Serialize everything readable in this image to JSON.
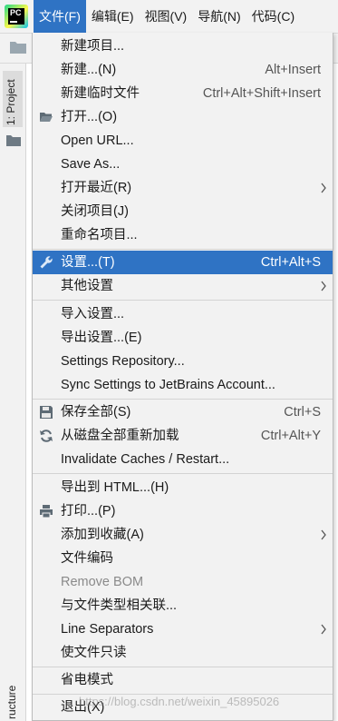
{
  "menubar": {
    "items": [
      "文件(F)",
      "编辑(E)",
      "视图(V)",
      "导航(N)",
      "代码(C)"
    ]
  },
  "tool_windows": {
    "project": "1: Project",
    "structure": "ructure"
  },
  "file_menu": {
    "items": [
      {
        "label": "新建项目...",
        "shortcut": ""
      },
      {
        "label": "新建...(N)",
        "shortcut": "Alt+Insert"
      },
      {
        "label": "新建临时文件",
        "shortcut": "Ctrl+Alt+Shift+Insert"
      },
      {
        "label": "打开...(O)",
        "shortcut": "",
        "icon": "folder-open-icon"
      },
      {
        "label": "Open URL...",
        "shortcut": ""
      },
      {
        "label": "Save As...",
        "shortcut": ""
      },
      {
        "label": "打开最近(R)",
        "shortcut": "",
        "submenu": true
      },
      {
        "label": "关闭项目(J)",
        "shortcut": ""
      },
      {
        "label": "重命名项目...",
        "shortcut": ""
      },
      {
        "label": "设置...(T)",
        "shortcut": "Ctrl+Alt+S",
        "icon": "wrench-icon",
        "selected": true
      },
      {
        "label": "其他设置",
        "shortcut": "",
        "submenu": true
      },
      {
        "label": "导入设置...",
        "shortcut": ""
      },
      {
        "label": "导出设置...(E)",
        "shortcut": ""
      },
      {
        "label": "Settings Repository...",
        "shortcut": ""
      },
      {
        "label": "Sync Settings to JetBrains Account...",
        "shortcut": ""
      },
      {
        "label": "保存全部(S)",
        "shortcut": "Ctrl+S",
        "icon": "save-icon"
      },
      {
        "label": "从磁盘全部重新加载",
        "shortcut": "Ctrl+Alt+Y",
        "icon": "reload-icon"
      },
      {
        "label": "Invalidate Caches / Restart...",
        "shortcut": ""
      },
      {
        "label": "导出到 HTML...(H)",
        "shortcut": ""
      },
      {
        "label": "打印...(P)",
        "shortcut": "",
        "icon": "printer-icon"
      },
      {
        "label": "添加到收藏(A)",
        "shortcut": "",
        "submenu": true
      },
      {
        "label": "文件编码",
        "shortcut": ""
      },
      {
        "label": "Remove BOM",
        "shortcut": "",
        "disabled": true
      },
      {
        "label": "与文件类型相关联...",
        "shortcut": ""
      },
      {
        "label": "Line Separators",
        "shortcut": "",
        "submenu": true
      },
      {
        "label": "使文件只读",
        "shortcut": ""
      },
      {
        "label": "省电模式",
        "shortcut": ""
      },
      {
        "label": "退出(X)",
        "shortcut": ""
      }
    ]
  },
  "watermark": "https://blog.csdn.net/weixin_45895026",
  "colors": {
    "selection": "#2f73c4",
    "menu_background": "#f2f2f2",
    "separator": "#d3d3d3",
    "disabled_text": "#8a8a8a"
  }
}
